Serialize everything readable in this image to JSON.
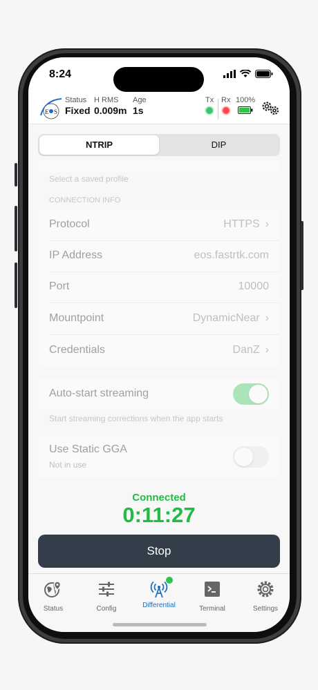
{
  "status_bar": {
    "time": "8:24"
  },
  "header": {
    "status_label": "Status",
    "status_value": "Fixed",
    "hrms_label": "H RMS",
    "hrms_value": "0.009m",
    "age_label": "Age",
    "age_value": "1s",
    "tx_label": "Tx",
    "rx_label": "Rx",
    "battery_label": "100%",
    "tx_color": "#3cc56b",
    "rx_color": "#ff4a4a"
  },
  "segments": [
    {
      "label": "NTRIP",
      "active": true
    },
    {
      "label": "DIP",
      "active": false
    }
  ],
  "profile_caption": "Select a saved profile",
  "connection_info": {
    "header": "CONNECTION INFO",
    "rows": [
      {
        "label": "Protocol",
        "value": "HTTPS",
        "chevron": true
      },
      {
        "label": "IP Address",
        "value": "eos.fastrtk.com",
        "chevron": false
      },
      {
        "label": "Port",
        "value": "10000",
        "chevron": false
      },
      {
        "label": "Mountpoint",
        "value": "DynamicNear",
        "chevron": true
      },
      {
        "label": "Credentials",
        "value": "DanZ",
        "chevron": true
      }
    ]
  },
  "auto_start": {
    "label": "Auto-start streaming",
    "caption": "Start streaming corrections when the app starts",
    "enabled": true
  },
  "static_gga": {
    "label": "Use Static GGA",
    "sublabel": "Not in use",
    "enabled": false
  },
  "connection": {
    "status": "Connected",
    "elapsed": "0:11:27"
  },
  "stop_button": "Stop",
  "tabs": [
    {
      "label": "Status",
      "icon": "globe-pin-icon",
      "active": false
    },
    {
      "label": "Config",
      "icon": "sliders-icon",
      "active": false
    },
    {
      "label": "Differential",
      "icon": "antenna-icon",
      "active": true
    },
    {
      "label": "Terminal",
      "icon": "terminal-icon",
      "active": false
    },
    {
      "label": "Settings",
      "icon": "gear-icon",
      "active": false
    }
  ],
  "colors": {
    "accent": "#1a6fc0",
    "connected": "#22bb44",
    "toggle_on": "#5ed07a",
    "stop_button": "#343e4a"
  }
}
